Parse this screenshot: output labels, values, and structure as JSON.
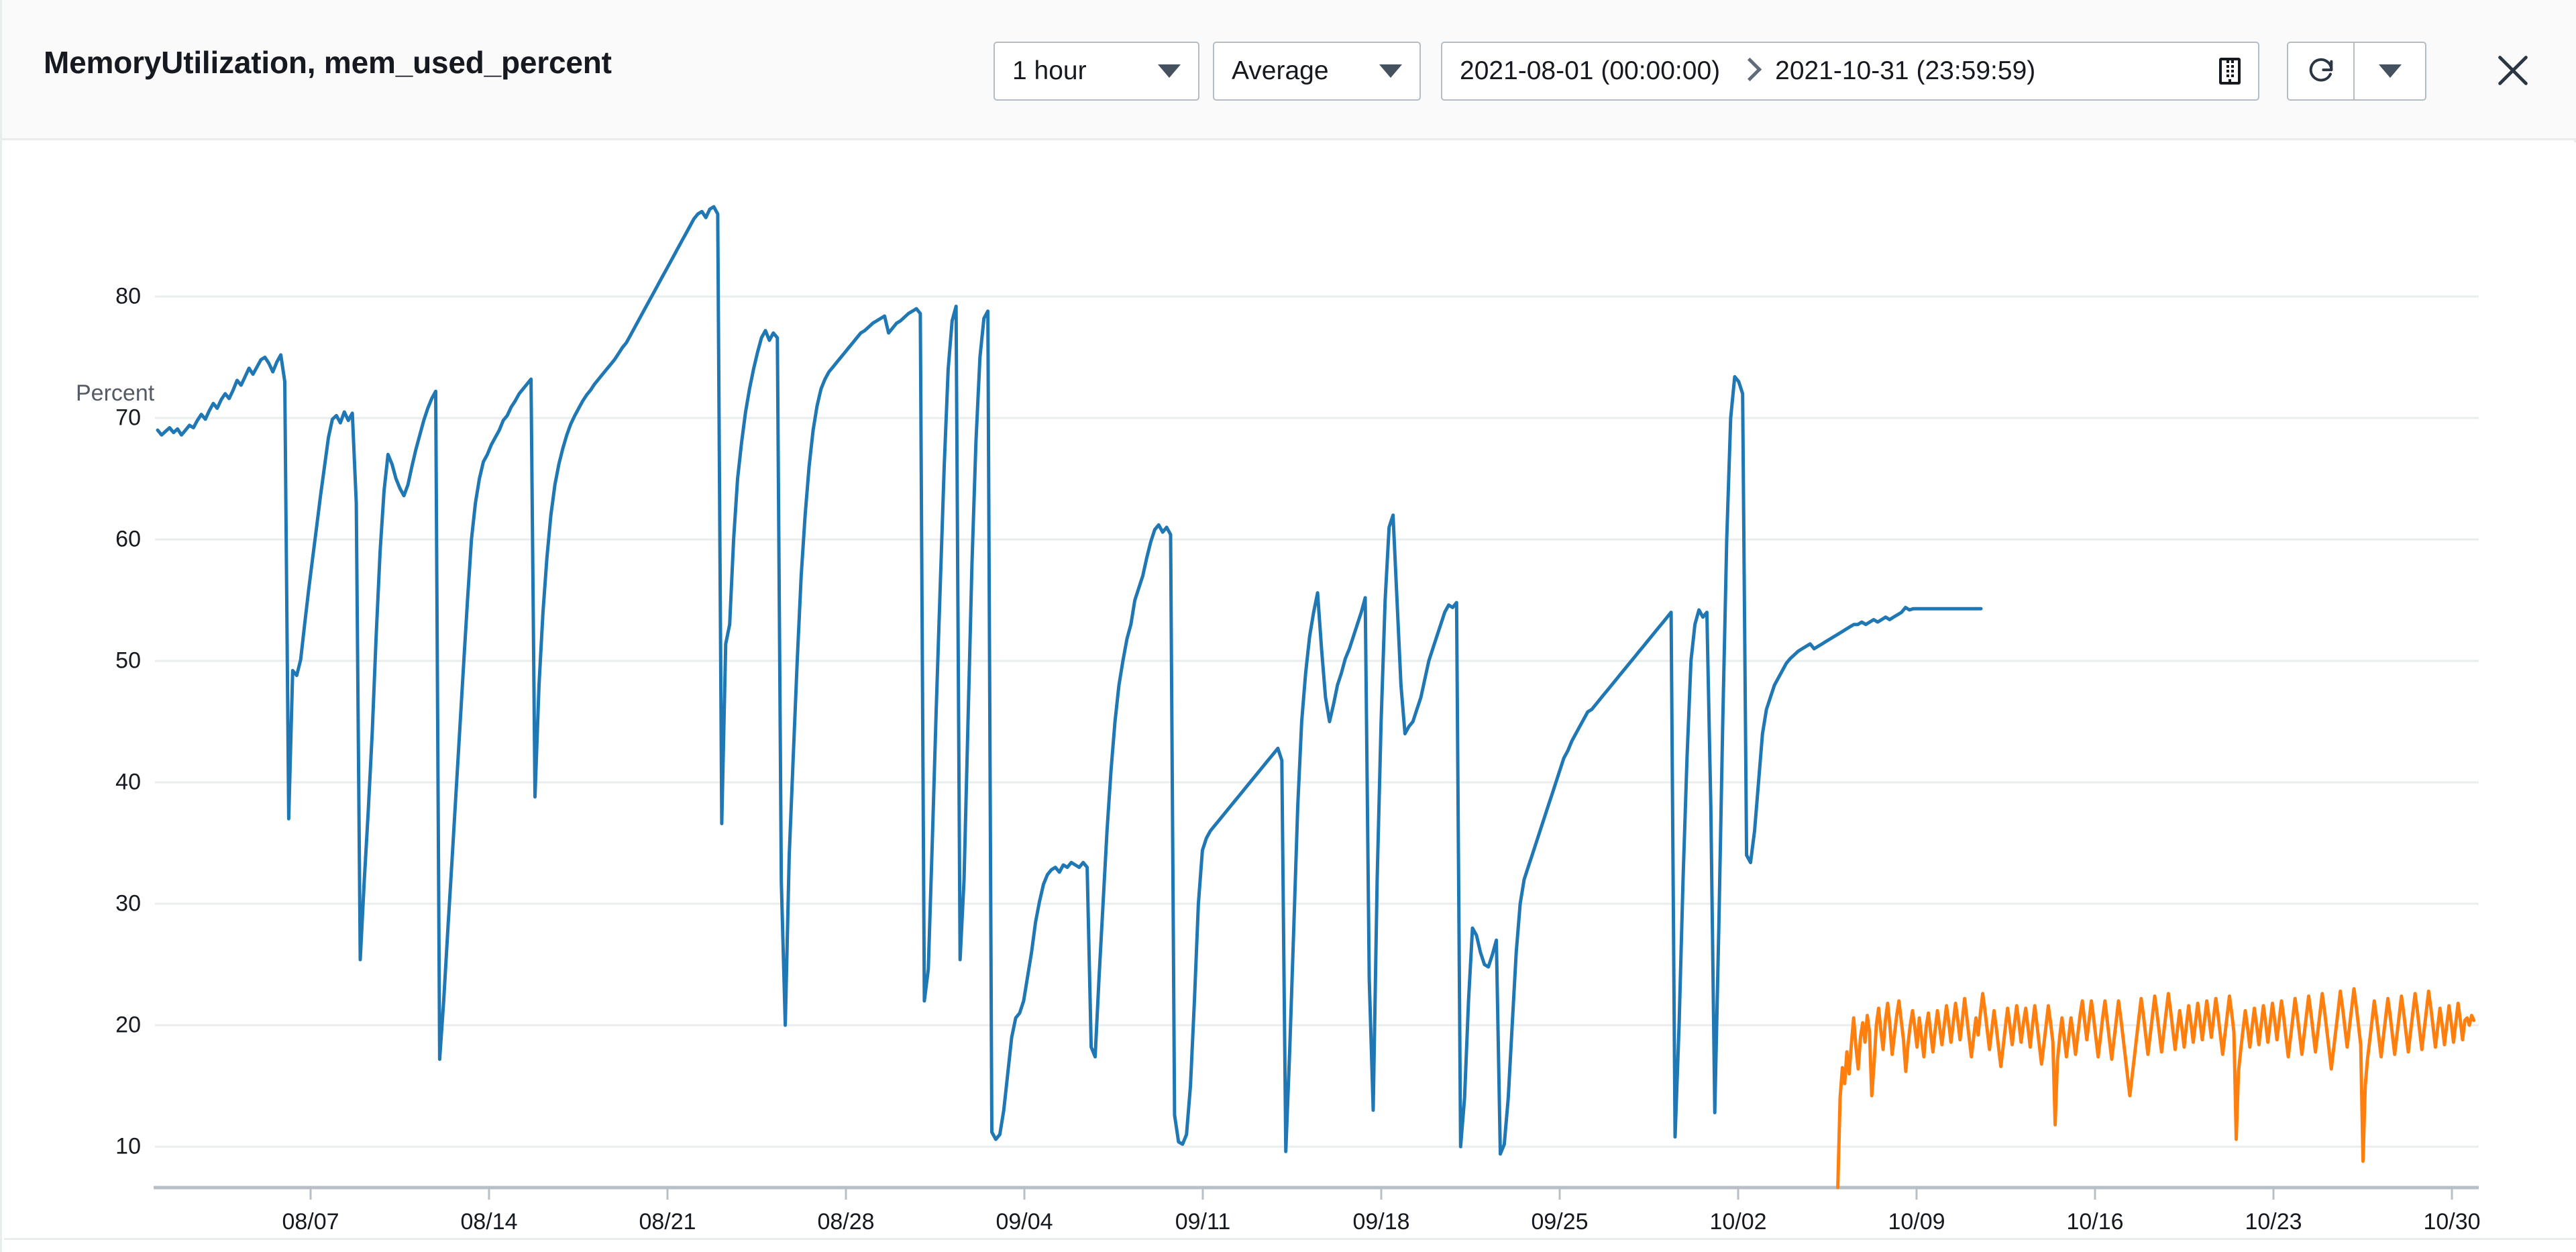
{
  "header": {
    "title": "MemoryUtilization, mem_used_percent",
    "period_label": "1 hour",
    "statistic_label": "Average",
    "date_start": "2021-08-01 (00:00:00)",
    "date_end": "2021-10-31 (23:59:59)",
    "calendar_icon": "calendar-icon",
    "range_separator_icon": "chevron-right-icon",
    "refresh_icon": "refresh-icon",
    "refresh_menu_icon": "chevron-down-icon",
    "close_icon": "close-icon"
  },
  "colors": {
    "series_blue": "#1f77b4",
    "series_orange": "#ff7f0e",
    "grid": "#eaeded",
    "axis": "#b8bfc6",
    "header_bg": "#fafafa",
    "text": "#16191f"
  },
  "chart_data": {
    "type": "line",
    "title": "MemoryUtilization, mem_used_percent",
    "ylabel": "Percent",
    "xlabel": "",
    "ylim": [
      0,
      88
    ],
    "grid": true,
    "legend": "none",
    "yticks": [
      10,
      20,
      30,
      40,
      50,
      60,
      70,
      80
    ],
    "xticks": [
      "08/07",
      "08/14",
      "08/21",
      "08/28",
      "09/04",
      "09/11",
      "09/18",
      "09/25",
      "10/02",
      "10/09",
      "10/16",
      "10/23",
      "10/30"
    ],
    "xrange": [
      "2021-08-01",
      "2021-10-31"
    ],
    "series": [
      {
        "name": "MemoryUtilization",
        "color": "#1f77b4",
        "x_start_frac": 0.0,
        "x_end_frac": 0.786,
        "values": [
          69.0,
          68.6,
          68.9,
          69.2,
          68.8,
          69.1,
          68.6,
          69.0,
          69.4,
          69.2,
          69.8,
          70.3,
          69.9,
          70.6,
          71.2,
          70.8,
          71.5,
          72.0,
          71.6,
          72.3,
          73.1,
          72.7,
          73.4,
          74.1,
          73.6,
          74.2,
          74.8,
          75.0,
          74.5,
          73.8,
          74.6,
          75.2,
          73.0,
          37.0,
          49.2,
          48.8,
          50.1,
          53.0,
          55.8,
          58.4,
          61.0,
          63.6,
          66.0,
          68.4,
          69.9,
          70.2,
          69.6,
          70.5,
          69.8,
          70.4,
          63.0,
          25.4,
          31.8,
          37.5,
          44.0,
          52.0,
          59.0,
          64.0,
          67.0,
          66.2,
          65.0,
          64.2,
          63.6,
          64.5,
          66.0,
          67.4,
          68.6,
          69.8,
          70.8,
          71.6,
          72.2,
          17.2,
          22.0,
          27.6,
          33.0,
          38.5,
          44.0,
          49.6,
          55.0,
          60.0,
          63.0,
          65.0,
          66.4,
          67.0,
          67.8,
          68.4,
          69.0,
          69.8,
          70.2,
          70.9,
          71.4,
          72.0,
          72.4,
          72.8,
          73.2,
          38.8,
          48.0,
          54.0,
          58.5,
          62.0,
          64.5,
          66.2,
          67.5,
          68.6,
          69.5,
          70.2,
          70.8,
          71.4,
          71.9,
          72.3,
          72.8,
          73.2,
          73.6,
          74.0,
          74.4,
          74.8,
          75.3,
          75.8,
          76.2,
          76.8,
          77.4,
          78.0,
          78.6,
          79.2,
          79.8,
          80.4,
          81.0,
          81.6,
          82.2,
          82.8,
          83.4,
          84.0,
          84.6,
          85.2,
          85.8,
          86.4,
          86.8,
          87.0,
          86.5,
          87.2,
          87.4,
          86.8,
          36.6,
          51.4,
          53.0,
          60.0,
          65.0,
          68.0,
          70.5,
          72.4,
          74.0,
          75.4,
          76.6,
          77.2,
          76.4,
          77.0,
          76.6,
          31.8,
          20.0,
          34.0,
          42.0,
          50.0,
          57.0,
          62.0,
          66.0,
          69.0,
          71.0,
          72.4,
          73.2,
          73.8,
          74.2,
          74.6,
          75.0,
          75.4,
          75.8,
          76.2,
          76.6,
          77.0,
          77.2,
          77.5,
          77.8,
          78.0,
          78.2,
          78.4,
          77.0,
          77.4,
          77.8,
          78.0,
          78.3,
          78.6,
          78.8,
          79.0,
          78.6,
          22.0,
          24.6,
          35.0,
          46.0,
          56.0,
          66.0,
          74.0,
          78.0,
          79.2,
          25.4,
          32.0,
          45.0,
          58.0,
          68.0,
          75.0,
          78.2,
          78.8,
          11.2,
          10.6,
          11.0,
          13.0,
          16.0,
          19.0,
          20.6,
          21.0,
          22.0,
          24.0,
          26.0,
          28.5,
          30.2,
          31.6,
          32.4,
          32.8,
          33.0,
          32.6,
          33.2,
          33.0,
          33.4,
          33.2,
          33.0,
          33.4,
          33.0,
          18.2,
          17.4,
          24.0,
          30.0,
          36.0,
          41.0,
          45.0,
          48.0,
          50.0,
          51.8,
          53.0,
          55.0,
          56.0,
          57.0,
          58.5,
          59.8,
          60.8,
          61.2,
          60.6,
          61.0,
          60.4,
          12.6,
          10.4,
          10.2,
          11.0,
          15.0,
          22.0,
          30.0,
          34.4,
          35.4,
          36.0,
          36.4,
          36.8,
          37.2,
          37.6,
          38.0,
          38.4,
          38.8,
          39.2,
          39.6,
          40.0,
          40.4,
          40.8,
          41.2,
          41.6,
          42.0,
          42.4,
          42.8,
          41.8,
          9.6,
          18.0,
          28.0,
          38.0,
          45.0,
          49.0,
          52.0,
          54.0,
          55.6,
          51.0,
          47.0,
          45.0,
          46.4,
          48.0,
          49.0,
          50.2,
          51.0,
          52.0,
          53.0,
          54.0,
          55.2,
          23.8,
          13.0,
          32.0,
          45.0,
          55.0,
          61.0,
          62.0,
          55.0,
          48.0,
          44.0,
          44.6,
          45.0,
          46.0,
          47.0,
          48.5,
          50.0,
          51.0,
          52.0,
          53.0,
          54.0,
          54.6,
          54.4,
          54.8,
          10.0,
          14.0,
          22.0,
          28.0,
          27.4,
          26.0,
          25.0,
          24.8,
          25.8,
          27.0,
          9.4,
          10.2,
          14.0,
          20.0,
          26.0,
          30.0,
          32.0,
          33.0,
          34.0,
          35.0,
          36.0,
          37.0,
          38.0,
          39.0,
          40.0,
          41.0,
          42.0,
          42.6,
          43.4,
          44.0,
          44.6,
          45.2,
          45.8,
          46.0,
          46.4,
          46.8,
          47.2,
          47.6,
          48.0,
          48.4,
          48.8,
          49.2,
          49.6,
          50.0,
          50.4,
          50.8,
          51.2,
          51.6,
          52.0,
          52.4,
          52.8,
          53.2,
          53.6,
          54.0,
          10.8,
          20.0,
          32.0,
          42.0,
          50.0,
          53.0,
          54.2,
          53.6,
          54.0,
          38.0,
          12.8,
          28.0,
          45.0,
          60.0,
          70.0,
          73.4,
          73.0,
          72.0,
          34.0,
          33.4,
          36.0,
          40.0,
          44.0,
          46.0,
          47.0,
          48.0,
          48.6,
          49.2,
          49.8,
          50.2,
          50.5,
          50.8,
          51.0,
          51.2,
          51.4,
          51.0,
          51.2,
          51.4,
          51.6,
          51.8,
          52.0,
          52.2,
          52.4,
          52.6,
          52.8,
          53.0,
          53.0,
          53.2,
          53.0,
          53.2,
          53.4,
          53.2,
          53.4,
          53.6,
          53.4,
          53.6,
          53.8,
          54.0,
          54.4,
          54.2,
          54.3,
          54.3,
          54.3,
          54.3,
          54.3,
          54.3,
          54.3,
          54.3,
          54.3,
          54.3,
          54.3,
          54.3,
          54.3,
          54.3,
          54.3,
          54.3,
          54.3,
          54.3
        ]
      },
      {
        "name": "mem_used_percent",
        "color": "#ff7f0e",
        "x_start_frac": 0.7243,
        "x_end_frac": 0.9985,
        "values": [
          0.5,
          14.0,
          16.5,
          15.2,
          17.8,
          16.0,
          18.5,
          20.6,
          18.2,
          16.4,
          19.0,
          20.2,
          18.6,
          20.8,
          19.4,
          14.2,
          16.8,
          20.0,
          21.4,
          19.6,
          18.0,
          20.4,
          21.8,
          20.0,
          17.6,
          19.2,
          20.8,
          22.0,
          20.4,
          18.8,
          16.2,
          18.4,
          20.0,
          21.2,
          19.8,
          18.2,
          20.6,
          19.0,
          17.4,
          19.8,
          21.0,
          19.4,
          17.8,
          19.6,
          21.2,
          19.8,
          18.4,
          20.0,
          21.6,
          20.2,
          18.6,
          20.2,
          21.8,
          20.4,
          18.8,
          20.4,
          22.2,
          20.6,
          19.0,
          17.4,
          19.0,
          20.6,
          19.2,
          21.0,
          22.6,
          21.2,
          19.6,
          18.0,
          19.6,
          21.2,
          19.8,
          18.2,
          16.6,
          18.2,
          19.8,
          21.4,
          20.0,
          18.4,
          20.0,
          21.6,
          20.2,
          18.6,
          20.2,
          21.4,
          19.8,
          18.2,
          20.0,
          21.6,
          20.0,
          18.4,
          16.8,
          18.4,
          20.0,
          21.6,
          20.2,
          18.6,
          11.8,
          17.0,
          19.0,
          20.6,
          19.0,
          17.4,
          19.0,
          20.6,
          19.2,
          17.6,
          19.2,
          20.8,
          22.0,
          20.4,
          18.8,
          20.4,
          22.0,
          20.6,
          19.0,
          17.4,
          19.0,
          20.6,
          22.0,
          20.4,
          18.8,
          17.2,
          18.8,
          20.4,
          22.0,
          20.6,
          19.0,
          17.4,
          15.8,
          14.2,
          15.8,
          17.4,
          19.0,
          20.6,
          22.2,
          20.8,
          19.2,
          17.6,
          19.2,
          20.8,
          22.4,
          21.0,
          19.4,
          17.8,
          19.4,
          21.0,
          22.6,
          21.2,
          19.6,
          18.0,
          19.6,
          21.2,
          19.8,
          18.2,
          20.0,
          21.6,
          20.2,
          18.6,
          20.2,
          21.8,
          20.4,
          18.8,
          20.4,
          22.0,
          20.6,
          19.0,
          20.6,
          22.2,
          20.8,
          19.2,
          17.6,
          19.2,
          20.8,
          22.4,
          21.0,
          19.4,
          10.6,
          16.2,
          18.0,
          19.6,
          21.2,
          19.8,
          18.2,
          19.8,
          21.4,
          20.0,
          18.4,
          20.0,
          21.6,
          20.2,
          18.6,
          20.2,
          21.8,
          20.4,
          18.8,
          20.4,
          22.0,
          20.6,
          19.0,
          17.4,
          19.0,
          20.6,
          22.2,
          20.8,
          19.2,
          17.6,
          19.2,
          20.8,
          22.4,
          21.0,
          19.4,
          17.8,
          19.4,
          21.0,
          22.6,
          21.2,
          19.6,
          18.0,
          16.4,
          18.0,
          19.6,
          21.2,
          22.8,
          21.4,
          19.8,
          18.2,
          19.8,
          21.4,
          23.0,
          21.6,
          20.0,
          18.4,
          8.8,
          15.0,
          17.2,
          18.8,
          20.4,
          22.0,
          20.6,
          19.0,
          17.4,
          19.0,
          20.6,
          22.2,
          20.8,
          19.2,
          17.6,
          19.2,
          20.8,
          22.4,
          21.0,
          19.4,
          17.8,
          19.4,
          21.0,
          22.6,
          21.2,
          19.6,
          18.0,
          19.6,
          21.2,
          22.8,
          21.4,
          19.8,
          18.2,
          19.8,
          21.4,
          20.0,
          18.4,
          20.0,
          21.6,
          20.2,
          18.6,
          20.2,
          21.8,
          20.4,
          18.8,
          20.4,
          20.6,
          20.0,
          20.8,
          20.4
        ]
      }
    ]
  }
}
